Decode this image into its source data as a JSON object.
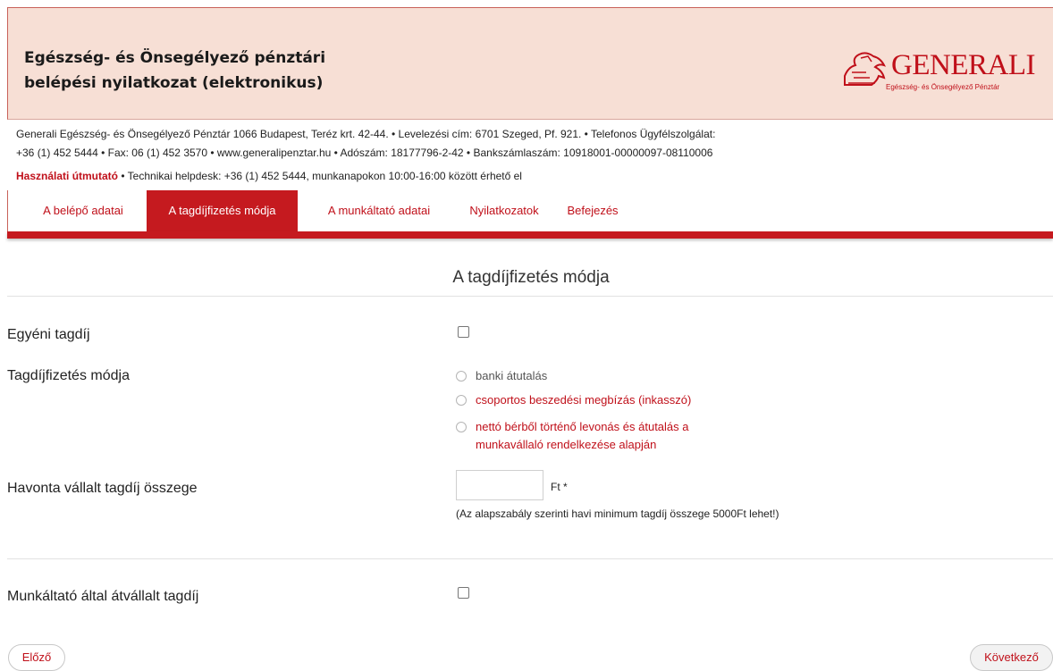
{
  "header": {
    "title": "Egészség- és Önsegélyező pénztári belépési nyilatkozat (elektronikus)",
    "logo_word": "GENERALI",
    "logo_sub": "Egészség- és Önsegélyező Pénztár"
  },
  "info": {
    "line1": "Generali Egészség- és Önsegélyező Pénztár 1066 Budapest, Teréz krt. 42-44. • Levelezési cím: 6701 Szeged, Pf. 921. • Telefonos Ügyfélszolgálat:",
    "line2": "+36 (1) 452 5444 • Fax: 06 (1) 452 3570 • www.generalipenztar.hu • Adószám: 18177796-2-42 • Bankszámlaszám: 10918001-00000097-08110006",
    "help_link": "Használati útmutató",
    "help_text": " • Technikai helpdesk: +36 (1) 452 5444, munkanapokon 10:00-16:00 között érhető el"
  },
  "tabs": [
    {
      "label": "A belépő adatai"
    },
    {
      "label": "A tagdíjfizetés módja"
    },
    {
      "label": "A munkáltató adatai"
    },
    {
      "label": "Nyilatkozatok"
    },
    {
      "label": "Befejezés"
    }
  ],
  "form": {
    "section_title": "A tagdíjfizetés módja",
    "individual_fee_label": "Egyéni tagdíj",
    "payment_method_label": "Tagdíjfizetés módja",
    "payment_options": [
      "banki átutalás",
      "csoportos beszedési megbízás (inkasszó)",
      "nettó bérből történő levonás és átutalás a",
      "munkavállaló rendelkezése alapján"
    ],
    "monthly_amount_label": "Havonta vállalt tagdíj összege",
    "monthly_amount_value": "",
    "unit": "Ft *",
    "note": "(Az alapszabály szerinti havi minimum tagdíj összege 5000Ft lehet!)",
    "employer_fee_label": "Munkáltató által átvállalt tagdíj"
  },
  "nav": {
    "prev": "Előző",
    "next": "Következő"
  },
  "colors": {
    "accent": "#c51a1f",
    "header_bg": "#f7dfd5"
  }
}
